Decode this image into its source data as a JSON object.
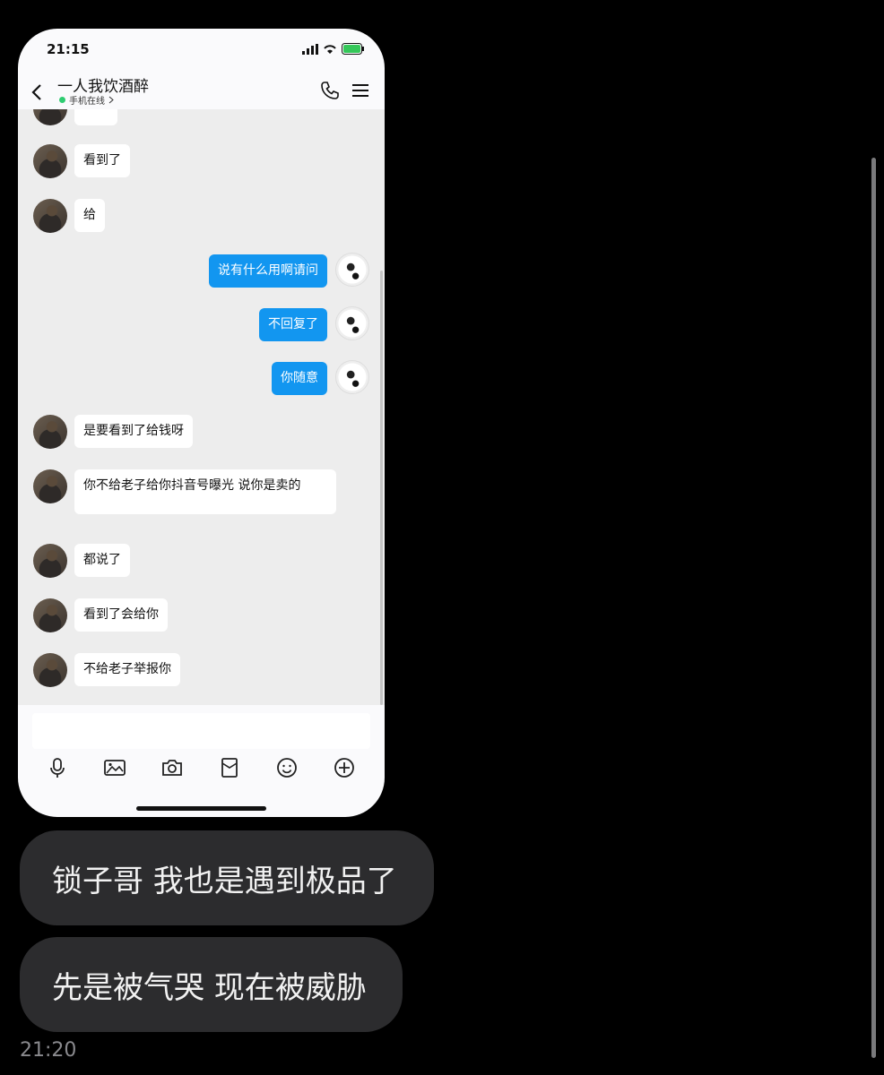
{
  "status_bar": {
    "time": "21:15"
  },
  "chat": {
    "title": "一人我饮酒醉",
    "status": "手机在线",
    "messages": [
      {
        "side": "left",
        "text": "看到了"
      },
      {
        "side": "left",
        "text": "给"
      },
      {
        "side": "right",
        "text": "说有什么用啊请问"
      },
      {
        "side": "right",
        "text": "不回复了"
      },
      {
        "side": "right",
        "text": "你随意"
      },
      {
        "side": "left",
        "text": "是要看到了给钱呀"
      },
      {
        "side": "left",
        "text": "你不给老子给你抖音号曝光 说你是卖的"
      },
      {
        "side": "left",
        "text": "都说了"
      },
      {
        "side": "left",
        "text": "看到了会给你"
      },
      {
        "side": "left",
        "text": "不给老子举报你"
      }
    ]
  },
  "toolbar_icons": [
    "mic-icon",
    "image-icon",
    "camera-icon",
    "red-packet-icon",
    "emoji-icon",
    "plus-icon"
  ],
  "outer_messages": [
    {
      "text": "锁子哥 我也是遇到极品了"
    },
    {
      "text": "先是被气哭 现在被威胁"
    }
  ],
  "footer_time": "21:20",
  "colors": {
    "bubble_blue": "#1296f0",
    "dark_bubble": "#2c2c2e",
    "background": "#000000"
  }
}
